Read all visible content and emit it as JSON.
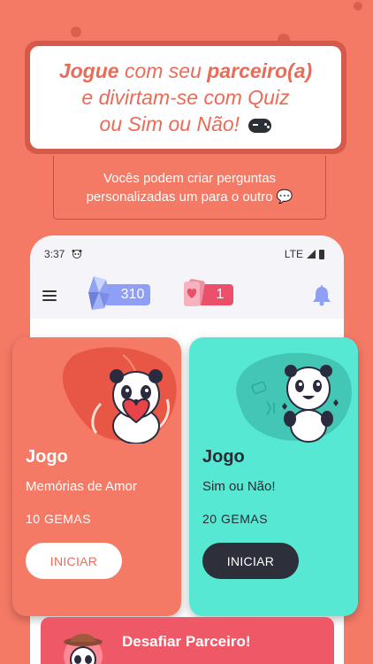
{
  "headline": {
    "line1_bold": "Jogue",
    "line1_mid": " com seu ",
    "line1_bold2": "parceiro(a)",
    "line2": "e divirtam-se com Quiz",
    "line3": "ou Sim ou Não!",
    "line3_icon": "gamepad-icon"
  },
  "subtitle": {
    "line1": "Vocês podem criar perguntas",
    "line2": "personalizadas um para o outro 💬"
  },
  "status_bar": {
    "time": "3:37",
    "network": "LTE"
  },
  "app_bar": {
    "gems": "310",
    "cards": "1"
  },
  "games": [
    {
      "title": "Jogo",
      "subtitle": "Memórias de Amor",
      "price": "10 GEMAS",
      "button": "INICIAR"
    },
    {
      "title": "Jogo",
      "subtitle": "Sim ou Não!",
      "price": "20 GEMAS",
      "button": "INICIAR"
    }
  ],
  "challenge": {
    "title": "Desafiar Parceiro!"
  },
  "colors": {
    "background": "#f47a66",
    "headline_text": "#ea6b58",
    "gem_pill": "#8f9ff5",
    "card_pill": "#ec4f6a",
    "love_card": "#f47a66",
    "yesno_card": "#57e8d4",
    "challenge": "#ef5867"
  }
}
